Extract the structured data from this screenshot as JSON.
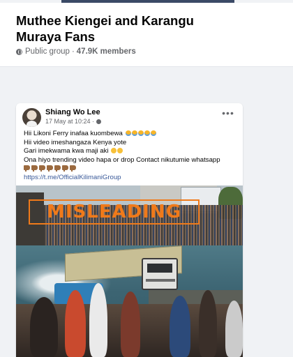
{
  "group": {
    "name": "Muthee Kiengei and Karangu Muraya Fans",
    "privacy": "Public group",
    "separator": "·",
    "members": "47.9K members"
  },
  "post": {
    "author": "Shiang Wo Lee",
    "time": "17 May at 10:24 ·",
    "more": "•••",
    "lines": [
      "Hii Likoni Ferry inafaa kuombewa",
      "Hii video imeshangaza Kenya yote",
      "Gari imekwama kwa maji aki",
      "Ona hiyo trending video hapa or drop Contact nikutumie whatsapp"
    ],
    "link": "https://t.me/OfficialKilimaniGroup"
  },
  "photo": {
    "label": "MISLEADING",
    "label_color": "#f07a1a"
  },
  "icons": {
    "globe": "globe-icon",
    "more": "more-options-icon",
    "crying": "crying-face-emoji",
    "sad": "sad-face-emoji",
    "hand": "pointing-down-hand-emoji"
  },
  "colors": {
    "background": "#f0f2f5",
    "card": "#ffffff",
    "secondary_text": "#65676b",
    "link": "#385898"
  }
}
